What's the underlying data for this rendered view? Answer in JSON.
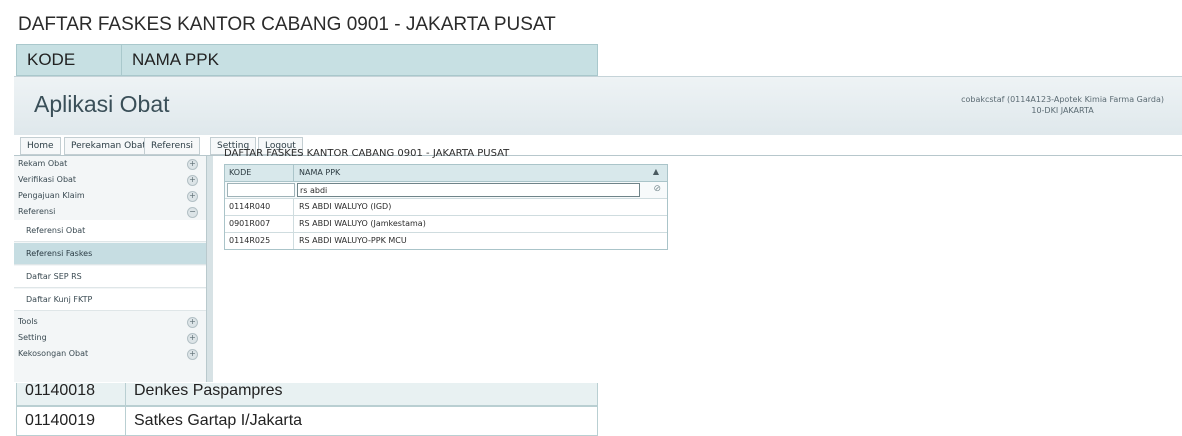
{
  "background": {
    "title": "DAFTAR FASKES KANTOR CABANG 0901 - JAKARTA PUSAT",
    "columns": [
      "KODE",
      "NAMA PPK"
    ],
    "rows": [
      {
        "kode": "01140018",
        "nama": "Denkes Paspampres"
      },
      {
        "kode": "01140019",
        "nama": "Satkes Gartap I/Jakarta"
      }
    ]
  },
  "app": {
    "title": "Aplikasi Obat",
    "user_line1": "cobakcstaf (0114A123-Apotek Kimia Farma Garda)",
    "user_line2": "10-DKI JAKARTA",
    "menu": [
      "Home",
      "Perekaman Obat",
      "Referensi",
      "Setting",
      "Logout"
    ],
    "sidebar": {
      "sections": [
        "Rekam Obat",
        "Verifikasi Obat",
        "Pengajuan Klaim",
        "Referensi"
      ],
      "sub_items": [
        "Referensi Obat",
        "Referensi Faskes",
        "Daftar SEP RS",
        "Daftar Kunj FKTP"
      ],
      "active_sub": "Referensi Faskes",
      "bottom_sections": [
        "Tools",
        "Setting",
        "Kekosongan Obat"
      ]
    },
    "content": {
      "title": "DAFTAR FASKES KANTOR CABANG 0901 - JAKARTA PUSAT",
      "columns": [
        "KODE",
        "NAMA PPK"
      ],
      "filter_kode": "",
      "filter_nama": "rs abdi",
      "rows": [
        {
          "kode": "0114R040",
          "nama": "RS ABDI WALUYO (IGD)"
        },
        {
          "kode": "0901R007",
          "nama": "RS ABDI WALUYO (Jamkestama)"
        },
        {
          "kode": "0114R025",
          "nama": "RS ABDI WALUYO-PPK MCU"
        }
      ]
    }
  }
}
